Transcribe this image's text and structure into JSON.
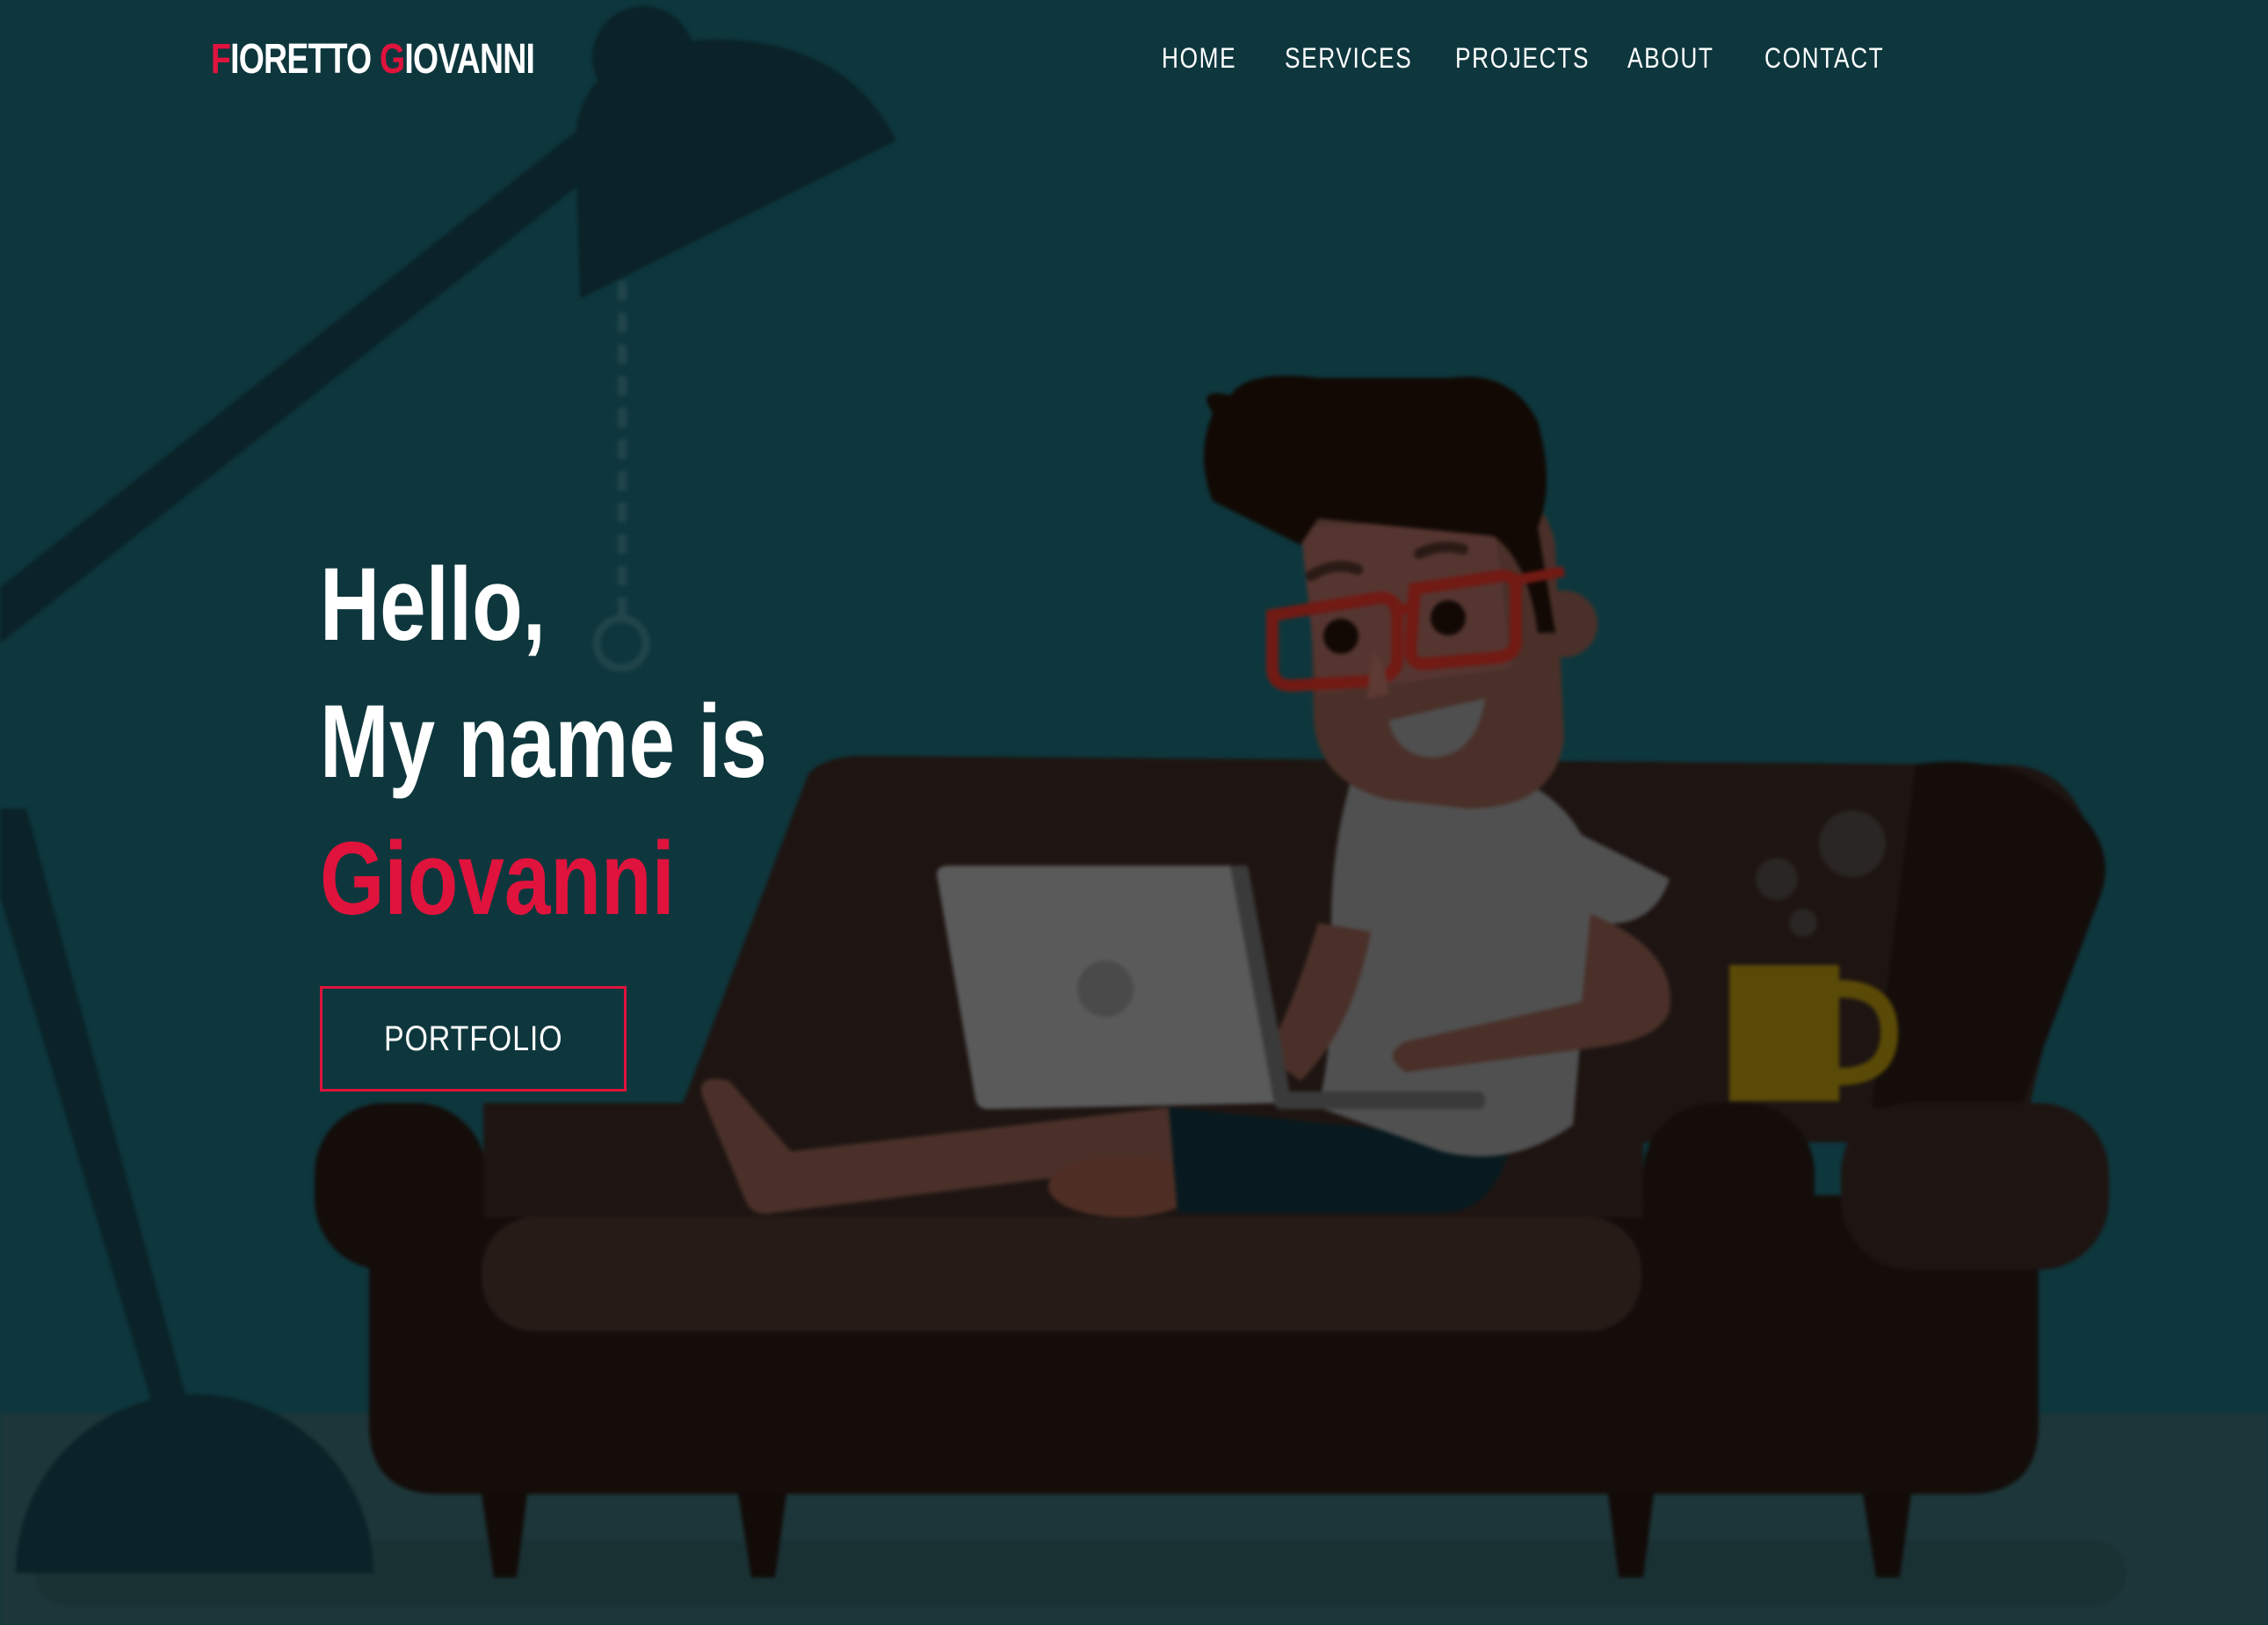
{
  "header": {
    "logo": {
      "first_initial": "F",
      "first_rest": "IORETTO",
      "last_initial": "G",
      "last_rest": "IOVANNI"
    },
    "nav": [
      {
        "label": "HOME"
      },
      {
        "label": "SERVICES"
      },
      {
        "label": "PROJECTS"
      },
      {
        "label": "ABOUT"
      },
      {
        "label": "CONTACT"
      }
    ]
  },
  "hero": {
    "line1": "Hello,",
    "line2": "My name is",
    "name": "Giovanni",
    "button_label": "PORTFOLIO"
  },
  "colors": {
    "background": "#0e373d",
    "accent": "#e0133d",
    "text": "#ffffff"
  },
  "illustration": {
    "icons": [
      "desk-lamp-icon",
      "sofa-icon",
      "person-with-laptop-icon",
      "coffee-mug-icon"
    ]
  }
}
